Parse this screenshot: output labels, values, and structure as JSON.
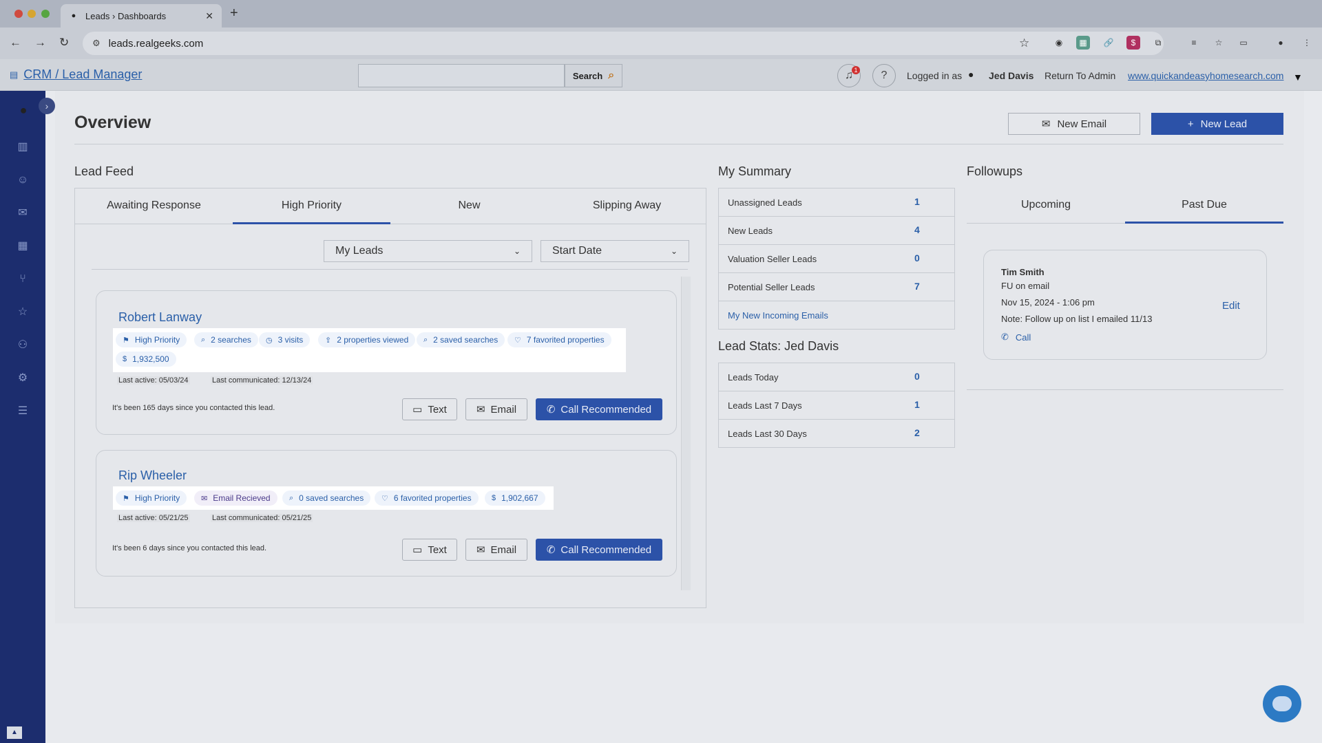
{
  "browser": {
    "tab_title": "Leads › Dashboards",
    "tab_close": "✕",
    "new_tab": "+",
    "url": "leads.realgeeks.com"
  },
  "header": {
    "crm_link": "CRM / Lead Manager",
    "search_placeholder": "",
    "search_button": "Search",
    "notification_count": "1",
    "logged_in_label": "Logged in as",
    "user_name": "Jed Davis",
    "return_admin": "Return To Admin",
    "site_link": "www.quickandeasyhomesearch.com"
  },
  "sidebar": {
    "icons": [
      "chart-icon",
      "users-icon",
      "mail-icon",
      "calendar-icon",
      "funnel-icon",
      "star-icon",
      "user-settings-icon",
      "gear-icon",
      "checklist-icon"
    ]
  },
  "overview": {
    "title": "Overview",
    "new_email": "New Email",
    "new_lead": "New Lead"
  },
  "lead_feed": {
    "title": "Lead Feed",
    "tabs": [
      "Awaiting Response",
      "High Priority",
      "New",
      "Slipping Away"
    ],
    "active_tab": "High Priority",
    "filter_owner": "My Leads",
    "filter_sort": "Start Date",
    "leads": [
      {
        "name": "Robert Lanway",
        "chips": [
          "High Priority",
          "2 searches",
          "3 visits",
          "2 properties viewed",
          "2 saved searches",
          "7 favorited properties",
          "1,932,500"
        ],
        "last_active": "Last active: 05/03/24",
        "last_communicated": "Last communicated: 12/13/24",
        "since": "It's been 165 days since you contacted this lead.",
        "text_btn": "Text",
        "email_btn": "Email",
        "call_btn": "Call Recommended"
      },
      {
        "name": "Rip Wheeler",
        "chips": [
          "High Priority",
          "Email Recieved",
          "0 saved searches",
          "6 favorited properties",
          "1,902,667"
        ],
        "last_active": "Last active: 05/21/25",
        "last_communicated": "Last communicated: 05/21/25",
        "since": "It's been 6 days since you contacted this lead.",
        "text_btn": "Text",
        "email_btn": "Email",
        "call_btn": "Call Recommended"
      }
    ]
  },
  "summary": {
    "title": "My Summary",
    "rows": [
      {
        "label": "Unassigned Leads",
        "value": "1"
      },
      {
        "label": "New Leads",
        "value": "4"
      },
      {
        "label": "Valuation Seller Leads",
        "value": "0"
      },
      {
        "label": "Potential Seller Leads",
        "value": "7"
      }
    ],
    "incoming_link": "My New Incoming Emails"
  },
  "lead_stats": {
    "title": "Lead Stats: Jed Davis",
    "rows": [
      {
        "label": "Leads Today",
        "value": "0"
      },
      {
        "label": "Leads Last 7 Days",
        "value": "1"
      },
      {
        "label": "Leads Last 30 Days",
        "value": "2"
      }
    ]
  },
  "followups": {
    "title": "Followups",
    "tabs": [
      "Upcoming",
      "Past Due"
    ],
    "active_tab": "Past Due",
    "item": {
      "name": "Tim Smith",
      "type": "FU on email",
      "date": "Nov 15, 2024 - 1:06 pm",
      "note": "Note: Follow up on list I emailed 11/13",
      "call": "Call",
      "edit": "Edit"
    }
  },
  "colors": {
    "accent": "#2c52a8",
    "sidebar": "#1c2d6e",
    "link": "#2a5fa8"
  }
}
